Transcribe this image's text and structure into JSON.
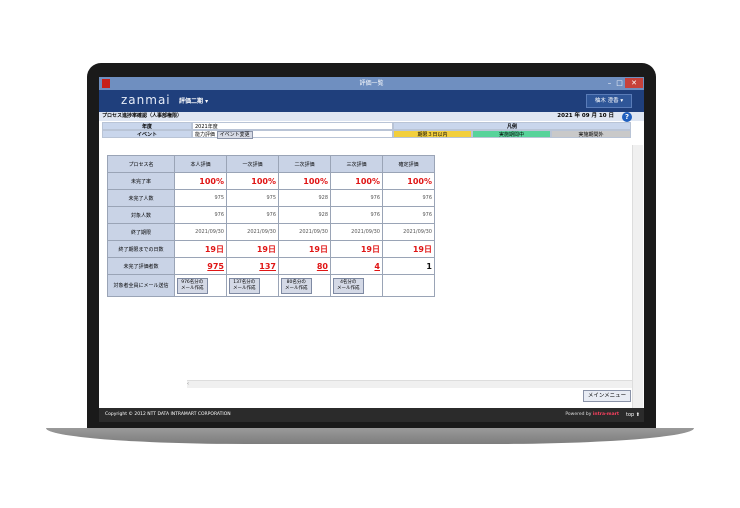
{
  "window": {
    "title": "評価一覧"
  },
  "header": {
    "logo": "zanmai",
    "menu": "評価二期 ▾",
    "user": "柚木 澄香 ▾"
  },
  "subheader": {
    "title": "プロセス進捗率確認（人事部権限）",
    "date": "2021 年 09 月 10 日",
    "help": "?"
  },
  "info": {
    "year_label": "年度",
    "year_value": "2021年度",
    "event_label": "イベント",
    "event_value": "能力評価",
    "event_change_button": "イベント変更",
    "legend_label": "凡例",
    "legend": [
      "期限３日以内",
      "実施期間中",
      "実施期間外"
    ]
  },
  "table": {
    "corner": "プロセス名",
    "columns": [
      "本人評価",
      "一次評価",
      "二次評価",
      "三次評価",
      "確定評価"
    ],
    "rows": [
      {
        "label": "未完了率",
        "values": [
          "100%",
          "100%",
          "100%",
          "100%",
          "100%"
        ]
      },
      {
        "label": "未完了人数",
        "values": [
          "975",
          "975",
          "928",
          "976",
          "976"
        ]
      },
      {
        "label": "対象人数",
        "values": [
          "976",
          "976",
          "928",
          "976",
          "976"
        ]
      },
      {
        "label": "終了期限",
        "values": [
          "2021/09/30",
          "2021/09/30",
          "2021/09/30",
          "2021/09/30",
          "2021/09/30"
        ]
      },
      {
        "label": "終了期限までの日数",
        "values": [
          "19日",
          "19日",
          "19日",
          "19日",
          "19日"
        ]
      },
      {
        "label": "未完了評価者数",
        "values": [
          "975",
          "137",
          "80",
          "4",
          "1"
        ]
      }
    ],
    "mail_row_label": "対象者全員にメール送信",
    "mail_buttons": [
      "976名分の\nメール作成",
      "137名分の\nメール作成",
      "80名分の\nメール作成",
      "4名分の\nメール作成"
    ]
  },
  "buttons": {
    "main_menu": "メインメニュー"
  },
  "footer": {
    "copyright": "Copyright © 2012 NTT DATA INTRAMART CORPORATION",
    "powered": "Powered by",
    "brand": "intra-mart",
    "top": "top ⬆"
  }
}
